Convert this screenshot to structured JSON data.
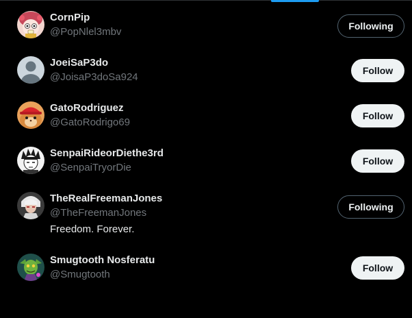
{
  "colors": {
    "background": "#000000",
    "accent": "#1d9bf0",
    "primary_text": "#e7e9ea",
    "secondary_text": "#71767b",
    "follow_button_bg": "#eff3f4",
    "follow_button_text": "#0f1419",
    "following_button_border": "#536471"
  },
  "users": [
    {
      "display_name": "CornPip",
      "handle": "@PopNlel3mbv",
      "button_label": "Following",
      "avatar_icon": "cartoon-girl-avatar"
    },
    {
      "display_name": "JoeiSaP3do",
      "handle": "@JoisaP3doSa924",
      "button_label": "Follow",
      "avatar_icon": "default-profile-avatar"
    },
    {
      "display_name": "GatoRodriguez",
      "handle": "@GatoRodrigo69",
      "button_label": "Follow",
      "avatar_icon": "hamster-red-cap-avatar"
    },
    {
      "display_name": "SenpaiRideorDiethe3rd",
      "handle": "@SenpaiTryorDie",
      "button_label": "Follow",
      "avatar_icon": "manga-character-avatar"
    },
    {
      "display_name": "TheRealFreemanJones",
      "handle": "@TheFreemanJones",
      "bio": "Freedom. Forever.",
      "button_label": "Following",
      "avatar_icon": "white-haired-character-avatar"
    },
    {
      "display_name": "Smugtooth Nosferatu",
      "handle": "@Smugtooth",
      "button_label": "Follow",
      "avatar_icon": "green-goblin-avatar"
    }
  ]
}
